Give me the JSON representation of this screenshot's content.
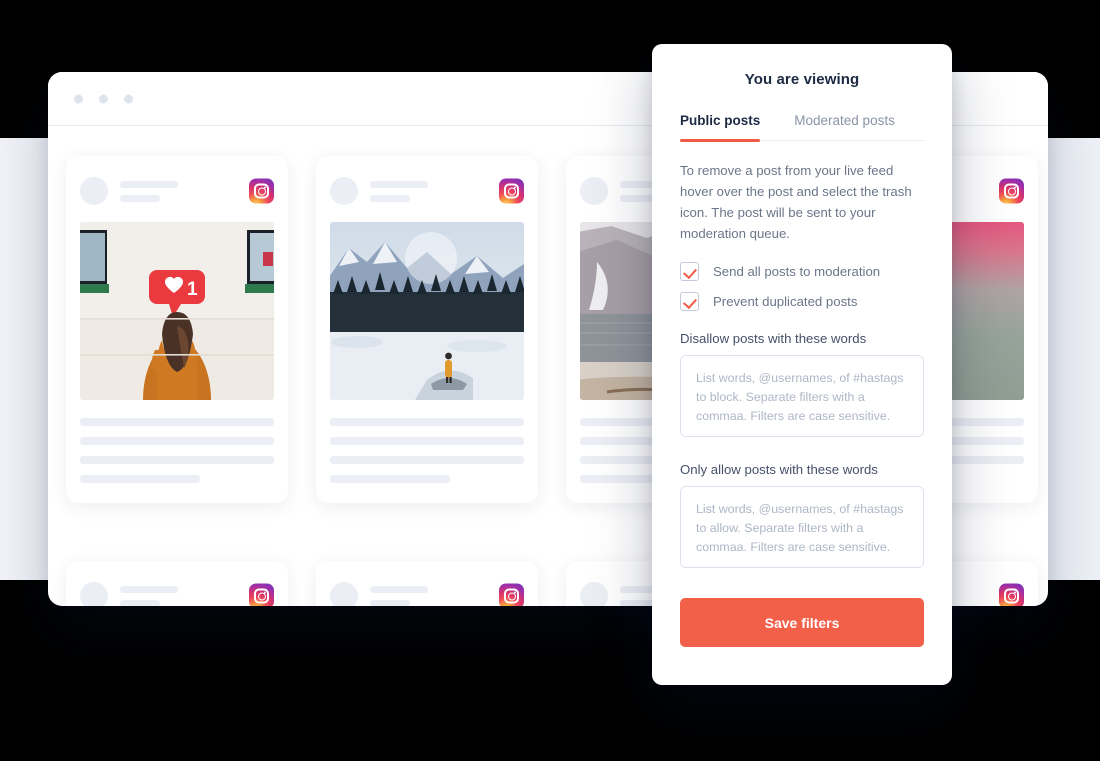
{
  "window": {
    "dots_label": "window-controls"
  },
  "feed": {
    "row1": [
      {
        "photo": "woman-orange-sweater-like-notification",
        "badge": "instagram-icon"
      },
      {
        "photo": "snowy-mountain-lake-person",
        "badge": "instagram-icon"
      },
      {
        "photo": "rocky-mountain-lake-shore",
        "badge": "instagram-icon"
      },
      {
        "photo": "pink-gray-blurred-scene",
        "badge": "instagram-icon"
      }
    ],
    "row2": [
      {
        "badge": "instagram-icon"
      },
      {
        "badge": "instagram-icon"
      },
      {
        "badge": "instagram-icon"
      },
      {
        "badge": "instagram-icon"
      }
    ]
  },
  "modal": {
    "title": "You are viewing",
    "tabs": [
      {
        "label": "Public posts",
        "active": true
      },
      {
        "label": "Moderated posts",
        "active": false
      }
    ],
    "description": "To remove a post from your live feed hover over the post and select the trash icon. The post will be sent to your moderation queue.",
    "checkboxes": [
      {
        "label": "Send all posts to moderation",
        "checked": true
      },
      {
        "label": "Prevent duplicated posts",
        "checked": true
      }
    ],
    "fields": [
      {
        "label": "Disallow posts with these words",
        "value": "",
        "placeholder": "List words, @usernames, of #hastags to block. Separate filters with a commaa. Filters are case sensitive."
      },
      {
        "label": "Only allow posts with these words",
        "value": "",
        "placeholder": "List words, @usernames, of #hastags to allow. Separate filters with a commaa. Filters are case sensitive."
      }
    ],
    "save_label": "Save filters"
  },
  "colors": {
    "accent": "#f2604a",
    "tab_underline": "#f15c44",
    "title_text": "#1d2a44",
    "body_text": "#6c7689",
    "skeleton": "#eceef5",
    "page_backdrop": "#f1f3f8"
  }
}
